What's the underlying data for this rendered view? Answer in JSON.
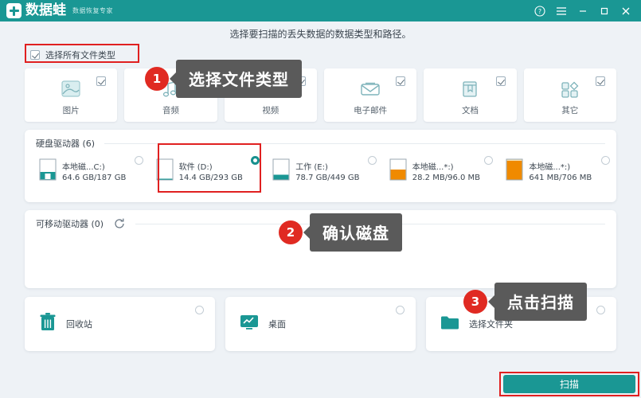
{
  "titlebar": {
    "logo_text": "数据蛙",
    "logo_subtitle": "数据恢复专家",
    "help_icon": "help-circle-icon",
    "menu_icon": "hamburger-menu-icon",
    "minimize_icon": "minimize-icon",
    "maximize_icon": "maximize-icon",
    "close_icon": "close-icon",
    "accent_color": "#1a9794"
  },
  "instruction": "选择要扫描的丢失数据的数据类型和路径。",
  "select_all": {
    "label": "选择所有文件类型",
    "checked": true,
    "highlight_color": "#e02020"
  },
  "file_types": [
    {
      "label": "图片",
      "icon": "image-icon",
      "checked": true
    },
    {
      "label": "音频",
      "icon": "audio-note-icon",
      "checked": true
    },
    {
      "label": "视频",
      "icon": "video-film-icon",
      "checked": true
    },
    {
      "label": "电子邮件",
      "icon": "email-envelope-icon",
      "checked": true
    },
    {
      "label": "文档",
      "icon": "document-bookmark-icon",
      "checked": true
    },
    {
      "label": "其它",
      "icon": "other-shapes-icon",
      "checked": true
    }
  ],
  "hard_drives": {
    "title": "硬盘驱动器 (6)",
    "items": [
      {
        "name": "本地磁...C:)",
        "size": "64.6 GB/187 GB",
        "selected": false,
        "bar_color": "#1a9794",
        "fill": 0.38
      },
      {
        "name": "软件 (D:)",
        "size": "14.4 GB/293 GB",
        "selected": true,
        "bar_color": "#1a9794",
        "fill": 0.05
      },
      {
        "name": "工作 (E:)",
        "size": "78.7 GB/449 GB",
        "selected": false,
        "bar_color": "#1a9794",
        "fill": 0.25
      },
      {
        "name": "本地磁...*:)",
        "size": "28.2 MB/96.0 MB",
        "selected": false,
        "bar_color": "#f08a00",
        "fill": 0.5
      },
      {
        "name": "本地磁...*:)",
        "size": "641 MB/706 MB",
        "selected": false,
        "bar_color": "#f08a00",
        "fill": 0.93
      }
    ]
  },
  "removable_drives": {
    "title": "可移动驱动器 (0)",
    "refresh_icon": "refresh-icon",
    "items": []
  },
  "sources": [
    {
      "label": "回收站",
      "icon": "trash-bin-icon",
      "selected": false
    },
    {
      "label": "桌面",
      "icon": "desktop-monitor-icon",
      "selected": false
    },
    {
      "label": "选择文件夹",
      "icon": "folder-icon",
      "selected": false
    }
  ],
  "scan_button": {
    "label": "扫描",
    "highlight_color": "#e02020",
    "button_color": "#1a9794"
  },
  "callouts": [
    {
      "number": "1",
      "text": "选择文件类型"
    },
    {
      "number": "2",
      "text": "确认磁盘"
    },
    {
      "number": "3",
      "text": "点击扫描"
    }
  ]
}
